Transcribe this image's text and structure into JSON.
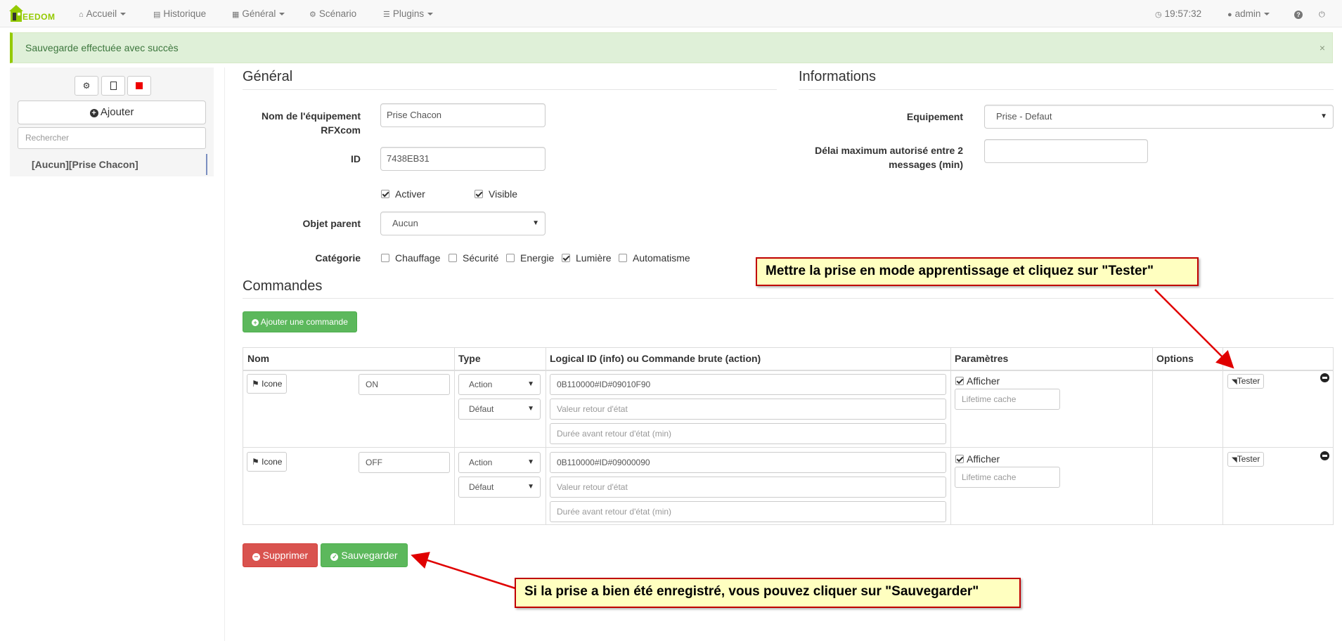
{
  "navbar": {
    "logo_letters": "EEDOM",
    "accueil": "Accueil",
    "historique": "Historique",
    "general": "Général",
    "scenario": "Scénario",
    "plugins": "Plugins",
    "time": "19:57:32",
    "user": "admin"
  },
  "alert": {
    "message": "Sauvegarde effectuée avec succès",
    "close": "×"
  },
  "sidebar": {
    "add_label": "Ajouter",
    "search_placeholder": "Rechercher",
    "items": [
      "[Aucun][Prise Chacon]"
    ]
  },
  "general": {
    "title": "Général",
    "name_label": "Nom de l'équipement RFXcom",
    "name_value": "Prise Chacon",
    "id_label": "ID",
    "id_value": "7438EB31",
    "activate_label": "Activer",
    "visible_label": "Visible",
    "parent_label": "Objet parent",
    "parent_value": "Aucun",
    "category_label": "Catégorie",
    "categories": [
      {
        "label": "Chauffage",
        "checked": false
      },
      {
        "label": "Sécurité",
        "checked": false
      },
      {
        "label": "Energie",
        "checked": false
      },
      {
        "label": "Lumière",
        "checked": true
      },
      {
        "label": "Automatisme",
        "checked": false
      }
    ]
  },
  "informations": {
    "title": "Informations",
    "equipment_label": "Equipement",
    "equipment_value": "Prise - Defaut",
    "delay_label": "Délai maximum autorisé entre 2 messages (min)",
    "delay_value": ""
  },
  "commands": {
    "title": "Commandes",
    "add_button": "Ajouter une commande",
    "headers": [
      "Nom",
      "Type",
      "Logical ID (info) ou Commande brute (action)",
      "Paramètres",
      "Options"
    ],
    "rows": [
      {
        "icon_button": "Icone",
        "name": "ON",
        "type": "Action",
        "subtype": "Défaut",
        "logical_id": "0B110000#ID#09010F90",
        "return_value_placeholder": "Valeur retour d'état",
        "return_delay_placeholder": "Durée avant retour d'état (min)",
        "show_label": "Afficher",
        "lifetime_placeholder": "Lifetime cache",
        "test_button": "Tester"
      },
      {
        "icon_button": "Icone",
        "name": "OFF",
        "type": "Action",
        "subtype": "Défaut",
        "logical_id": "0B110000#ID#09000090",
        "return_value_placeholder": "Valeur retour d'état",
        "return_delay_placeholder": "Durée avant retour d'état (min)",
        "show_label": "Afficher",
        "lifetime_placeholder": "Lifetime cache",
        "test_button": "Tester"
      }
    ]
  },
  "actions": {
    "delete": "Supprimer",
    "save": "Sauvegarder"
  },
  "annotations": {
    "test_hint": "Mettre la prise en mode apprentissage et cliquez sur \"Tester\"",
    "save_hint": "Si la prise a bien été enregistré, vous pouvez cliquer sur \"Sauvegarder\""
  },
  "colors": {
    "brand_green": "#94ca02",
    "success": "#5cb85c",
    "danger": "#d9534f",
    "annotation_red": "#e00000"
  }
}
